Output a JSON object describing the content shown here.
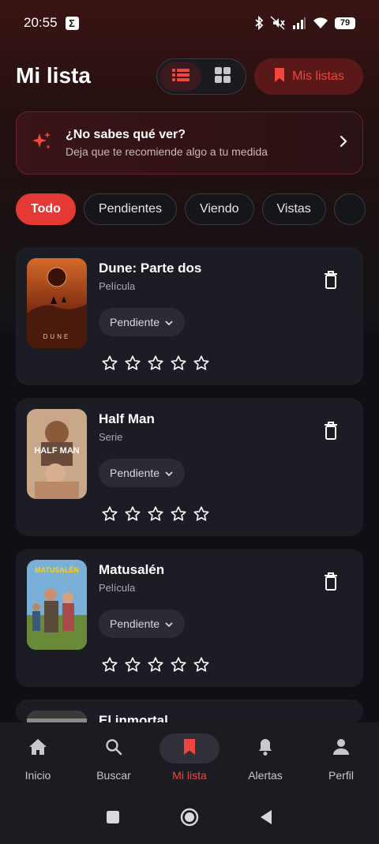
{
  "status_bar": {
    "time": "20:55",
    "notif_letter": "Σ",
    "battery": "79"
  },
  "header": {
    "title": "Mi lista",
    "my_lists_label": "Mis listas"
  },
  "recommend": {
    "title": "¿No sabes qué ver?",
    "subtitle": "Deja que te recomiende algo a tu medida"
  },
  "filters": [
    "Todo",
    "Pendientes",
    "Viendo",
    "Vistas"
  ],
  "active_filter": "Todo",
  "items": [
    {
      "title": "Dune: Parte dos",
      "type": "Película",
      "status": "Pendiente",
      "rating": 0,
      "poster_text": "DUNE"
    },
    {
      "title": "Half Man",
      "type": "Serie",
      "status": "Pendiente",
      "rating": 0,
      "poster_text": "HALF MAN"
    },
    {
      "title": "Matusalén",
      "type": "Película",
      "status": "Pendiente",
      "rating": 0,
      "poster_text": "MATUSALÉN"
    },
    {
      "title": "El inmortal"
    }
  ],
  "bottom_nav": [
    {
      "label": "Inicio",
      "icon": "home-icon"
    },
    {
      "label": "Buscar",
      "icon": "search-icon"
    },
    {
      "label": "Mi lista",
      "icon": "bookmark-icon",
      "active": true
    },
    {
      "label": "Alertas",
      "icon": "bell-icon"
    },
    {
      "label": "Perfil",
      "icon": "person-icon"
    }
  ],
  "colors": {
    "accent": "#e53935",
    "accent_text": "#f2453f",
    "card_bg": "#1c1d24",
    "page_bg": "#0f1014"
  }
}
